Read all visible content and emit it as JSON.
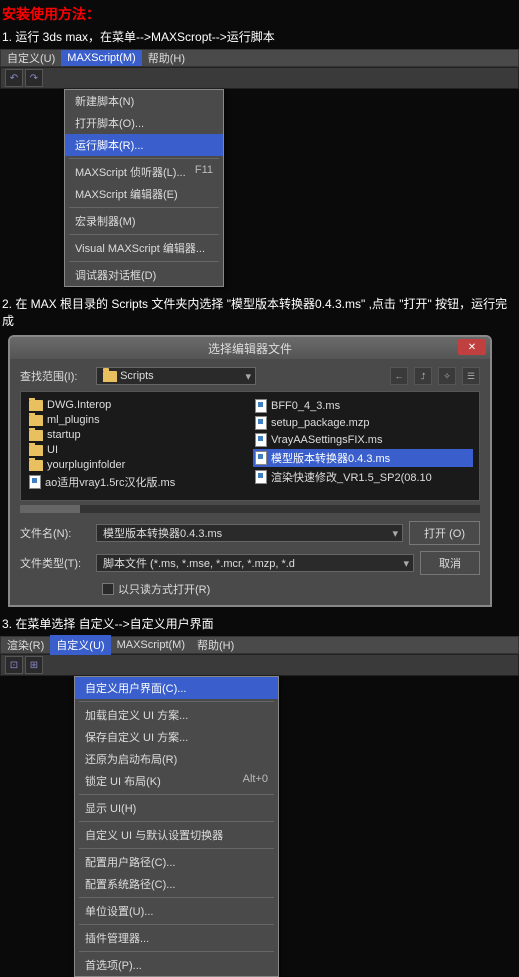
{
  "header": {
    "title": "安装使用方法："
  },
  "step1": {
    "text": "1. 运行 3ds max，在菜单-->MAXScropt-->运行脚本",
    "menubar": [
      "自定义(U)",
      "MAXScript(M)",
      "帮助(H)"
    ],
    "dropdown": [
      {
        "label": "新建脚本(N)"
      },
      {
        "label": "打开脚本(O)..."
      },
      {
        "label": "运行脚本(R)...",
        "highlight": true
      },
      {
        "sep": true
      },
      {
        "label": "MAXScript 侦听器(L)...",
        "shortcut": "F11"
      },
      {
        "label": "MAXScript 编辑器(E)"
      },
      {
        "sep": true
      },
      {
        "label": "宏录制器(M)"
      },
      {
        "sep": true
      },
      {
        "label": "Visual MAXScript 编辑器..."
      },
      {
        "sep": true
      },
      {
        "label": "调试器对话框(D)"
      }
    ]
  },
  "step2": {
    "text": "2. 在 MAX 根目录的 Scripts 文件夹内选择 \"模型版本转换器0.4.3.ms\" ,点击 \"打开\" 按钮，运行完成",
    "dialog_title": "选择编辑器文件",
    "range_label": "查找范围(I):",
    "range_value": "Scripts",
    "left_files": [
      {
        "name": "DWG.Interop",
        "type": "folder"
      },
      {
        "name": "ml_plugins",
        "type": "folder"
      },
      {
        "name": "startup",
        "type": "folder"
      },
      {
        "name": "UI",
        "type": "folder"
      },
      {
        "name": "yourpluginfolder",
        "type": "folder"
      },
      {
        "name": "ao适用vray1.5rc汉化版.ms",
        "type": "script"
      }
    ],
    "right_files": [
      {
        "name": "BFF0_4_3.ms",
        "type": "script"
      },
      {
        "name": "setup_package.mzp",
        "type": "script"
      },
      {
        "name": "VrayAASettingsFIX.ms",
        "type": "script"
      },
      {
        "name": "模型版本转换器0.4.3.ms",
        "type": "script",
        "selected": true
      },
      {
        "name": "渲染快速修改_VR1.5_SP2(08.10",
        "type": "script"
      }
    ],
    "filename_label": "文件名(N):",
    "filename_value": "模型版本转换器0.4.3.ms",
    "filetype_label": "文件类型(T):",
    "filetype_value": "脚本文件 (*.ms, *.mse, *.mcr, *.mzp, *.d",
    "open_btn": "打开 (O)",
    "cancel_btn": "取消",
    "readonly_label": "以只读方式打开(R)"
  },
  "step3": {
    "text": "3. 在菜单选择 自定义-->自定义用户界面",
    "menubar": [
      "渲染(R)",
      "自定义(U)",
      "MAXScript(M)",
      "帮助(H)"
    ],
    "dropdown": [
      {
        "label": "自定义用户界面(C)...",
        "highlight": true
      },
      {
        "sep": true
      },
      {
        "label": "加载自定义 UI 方案..."
      },
      {
        "label": "保存自定义 UI 方案..."
      },
      {
        "label": "还原为启动布局(R)"
      },
      {
        "label": "锁定 UI 布局(K)",
        "shortcut": "Alt+0"
      },
      {
        "sep": true
      },
      {
        "label": "显示 UI(H)"
      },
      {
        "sep": true
      },
      {
        "label": "自定义 UI 与默认设置切换器"
      },
      {
        "sep": true
      },
      {
        "label": "配置用户路径(C)..."
      },
      {
        "label": "配置系统路径(C)..."
      },
      {
        "sep": true
      },
      {
        "label": "单位设置(U)..."
      },
      {
        "sep": true
      },
      {
        "label": "插件管理器..."
      },
      {
        "sep": true
      },
      {
        "label": "首选项(P)..."
      }
    ]
  }
}
